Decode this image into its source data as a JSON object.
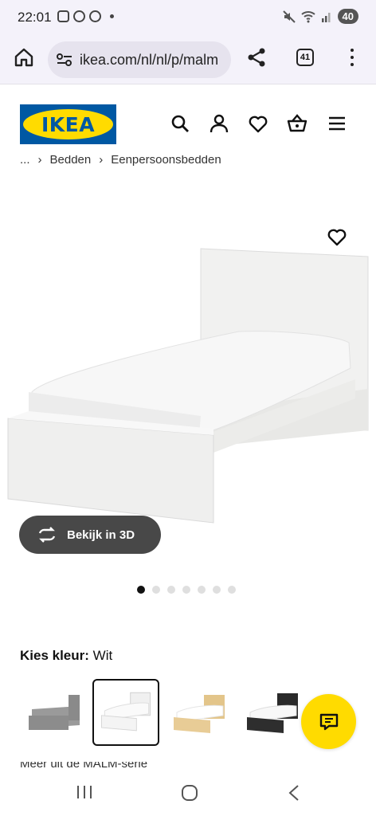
{
  "status": {
    "time": "22:01",
    "battery": "40"
  },
  "browser": {
    "url": "ikea.com/nl/nl/p/malm",
    "tab_count": "41"
  },
  "header": {
    "logo_text": "IKEA",
    "icons": [
      "search-icon",
      "account-icon",
      "heart-icon",
      "basket-icon",
      "hamburger-menu-icon"
    ]
  },
  "breadcrumb": {
    "ellipsis": "...",
    "items": [
      "Bedden",
      "Eenpersoonsbedden"
    ]
  },
  "product": {
    "view_3d_label": "Bekijk in 3D",
    "image_count": 7,
    "active_image_index": 0
  },
  "colors": {
    "label": "Kies kleur:",
    "selected": "Wit",
    "swatches": [
      {
        "name": "grijs",
        "color": "#8c8c8c"
      },
      {
        "name": "wit",
        "color": "#f4f4f4"
      },
      {
        "name": "eiken",
        "color": "#e8cc96"
      },
      {
        "name": "zwartbruin",
        "color": "#2e2e2e"
      }
    ]
  },
  "cut_off_text": "Meer uit de MALM-serie",
  "theme": {
    "ikea_blue": "#0058a3",
    "ikea_yellow": "#ffdb00",
    "button_dark": "#484848"
  }
}
